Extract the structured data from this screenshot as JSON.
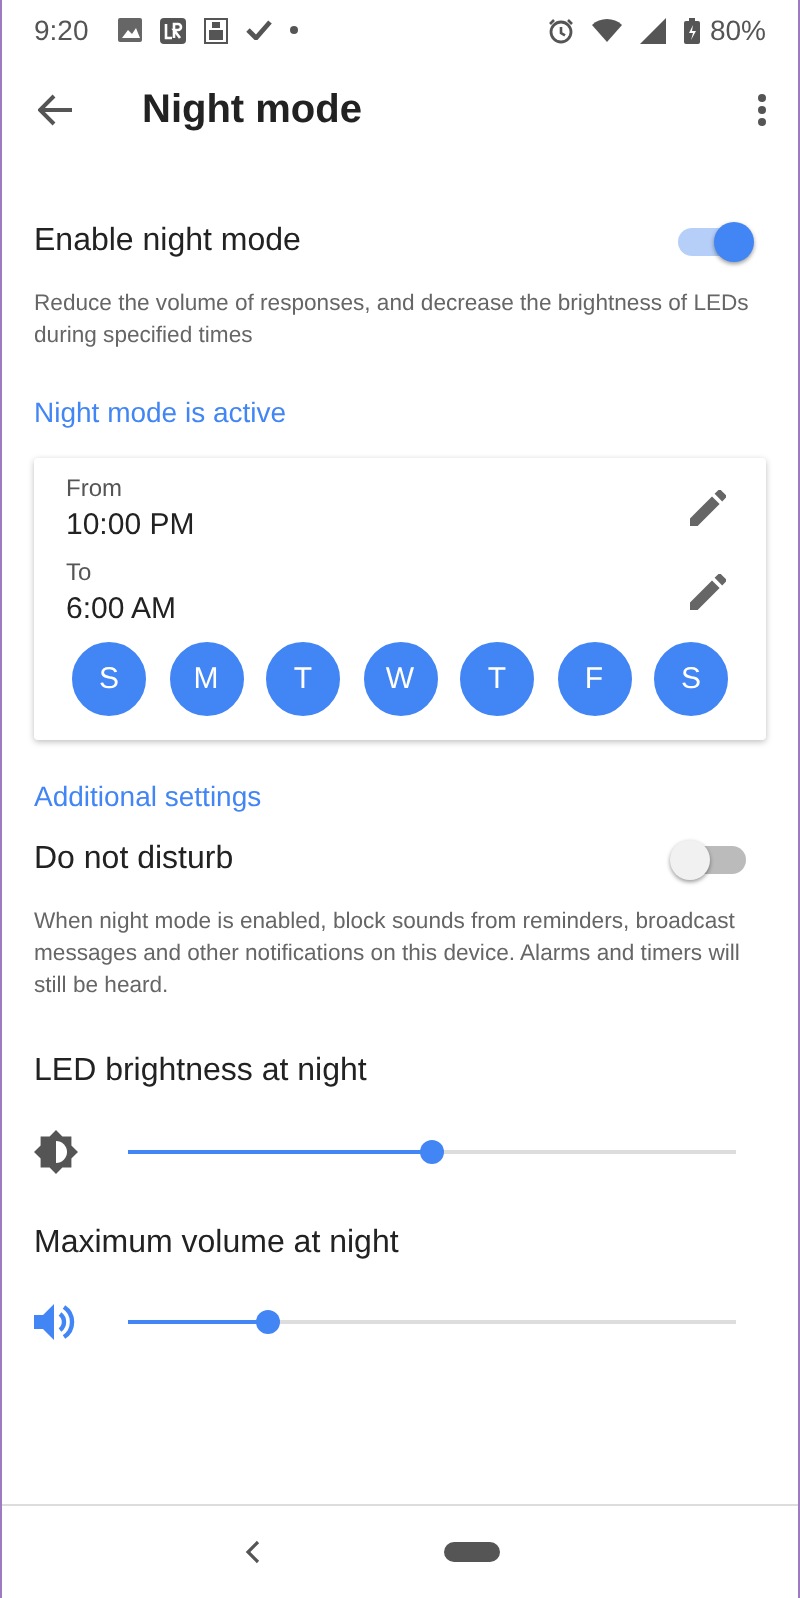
{
  "status_bar": {
    "time": "9:20",
    "battery": "80%"
  },
  "app_bar": {
    "title": "Night mode"
  },
  "enable": {
    "label": "Enable night mode",
    "on": true
  },
  "enable_description": "Reduce the volume of responses, and decrease the brightness of LEDs during specified times",
  "status_text": "Night mode is active",
  "schedule": {
    "from_label": "From",
    "from_time": "10:00 PM",
    "to_label": "To",
    "to_time": "6:00 AM",
    "days": [
      {
        "label": "S",
        "selected": true
      },
      {
        "label": "M",
        "selected": true
      },
      {
        "label": "T",
        "selected": true
      },
      {
        "label": "W",
        "selected": true
      },
      {
        "label": "T",
        "selected": true
      },
      {
        "label": "F",
        "selected": true
      },
      {
        "label": "S",
        "selected": true
      }
    ]
  },
  "additional_heading": "Additional settings",
  "do_not_disturb": {
    "label": "Do not disturb",
    "on": false
  },
  "dnd_description": "When night mode is enabled, block sounds from reminders, broadcast messages and other notifications on this device. Alarms and timers will still be heard.",
  "sliders": [
    {
      "kind": "brightness",
      "label": "LED brightness at night",
      "level": 0.5
    },
    {
      "kind": "volume",
      "label": "Maximum volume at night",
      "level": 0.23
    }
  ]
}
